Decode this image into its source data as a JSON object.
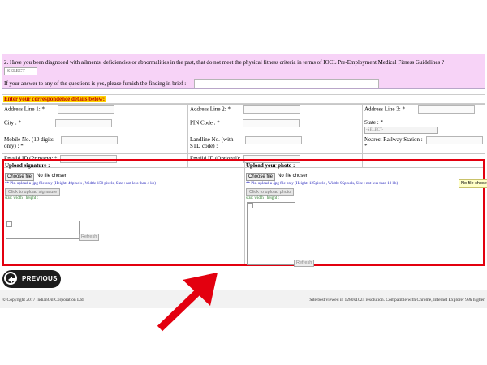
{
  "question2": {
    "text": "2. Have you been diagnosed with ailments, deficiencies or abnormalities in the past, that do not meet the physical fitness criteria in terms of IOCL Pre-Employment Medical Fitness Guidelines ?",
    "select_value": "-SELECT-",
    "finding_label": "If your answer to any of the questions is yes, please furnish the finding in brief :",
    "finding_value": ""
  },
  "correspondence": {
    "heading": "Enter your correspondence details below:",
    "address1": "Address Line 1: *",
    "address2": "Address Line 2: *",
    "address3": "Address Line 3: *",
    "city": "City : *",
    "pin": "PIN Code : *",
    "state": "State : *",
    "state_value": "-SELECT-",
    "mobile": "Mobile No. (10 digits only) : *",
    "landline": "Landline No. (with STD code) :",
    "railway": "Nearest Railway Station : *",
    "email_primary": "Emaild ID (Primary): *",
    "email_optional": "Emaild ID (Optional):"
  },
  "upload": {
    "signature": {
      "title": "Upload signature :",
      "choose_label": "Choose file",
      "no_file": "No file chosen",
      "note": "** Pls. upload a .jpg file only (Height: 40pixels , Width: 150 pixels, Size : not less than 4 kb)",
      "click_label": "Click to upload signature",
      "size_text": "size:  width :   height :",
      "refresh_label": "Refresh"
    },
    "photo": {
      "title": "Upload your photo :",
      "choose_label": "Choose file",
      "no_file": "No file chosen",
      "note": "** Pls. upload a .jpg file only (Height: 125pixels , Width: 95pixels, Size : not less than 10 kb)",
      "click_label": "Click to upload photo",
      "size_text": "size:  width :   height :",
      "refresh_label": "Refresh",
      "tooltip": "No file chosen"
    }
  },
  "nav": {
    "previous_label": "PREVIOUS"
  },
  "footer": {
    "copyright": "© Copyright 2017 IndianOil Corporation Ltd.",
    "compat": "Site best viewed in 1280x1024 resolution. Compatible with Chrome, Internet Explorer 9 & higher."
  },
  "colors": {
    "highlight_border": "#e3000f",
    "arrow": "#e3000f",
    "pink_panel": "#f7d3f7",
    "heading_bg": "#ffd400"
  }
}
